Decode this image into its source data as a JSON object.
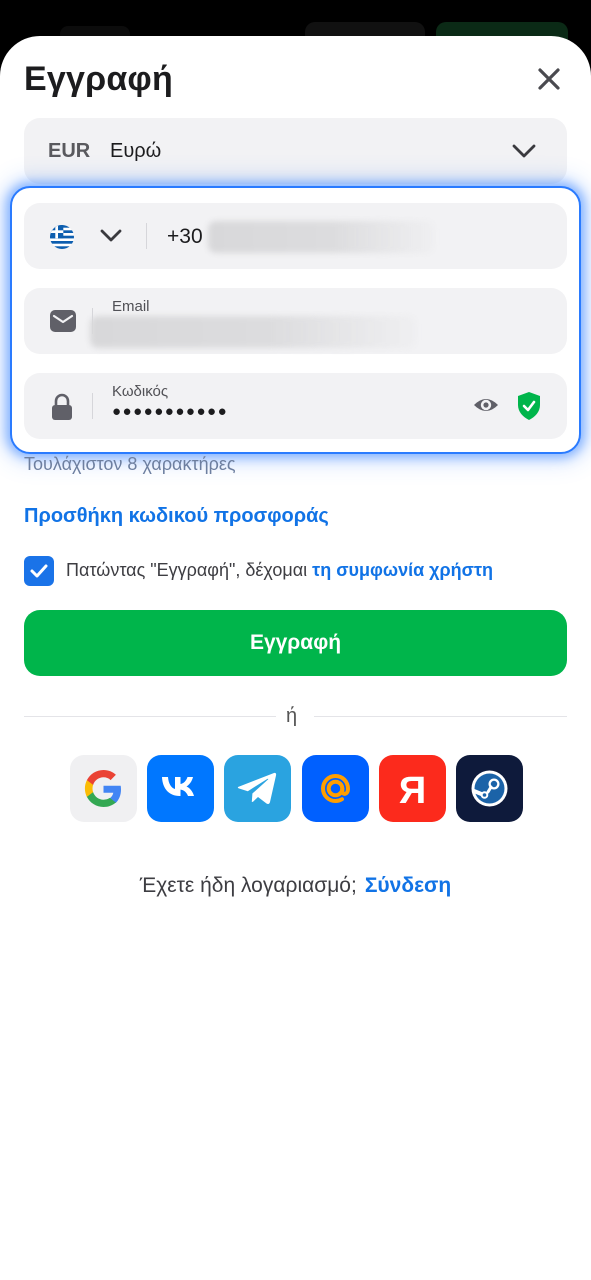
{
  "header": {
    "title": "Εγγραφή",
    "close_icon": "close-icon"
  },
  "currency": {
    "code": "EUR",
    "name": "Ευρώ",
    "icon": "chevron-down-icon"
  },
  "phone": {
    "country_flag": "greece-flag-icon",
    "prefix": "+30",
    "value_hidden": true
  },
  "email": {
    "label": "Email",
    "icon": "envelope-icon",
    "value_hidden": true
  },
  "password": {
    "label": "Κωδικός",
    "masked_value": "●●●●●●●●●●●",
    "icon": "lock-icon",
    "eye_icon": "eye-icon",
    "status_icon": "shield-check-icon",
    "hint": "Τουλάχιστον 8 χαρακτήρες"
  },
  "promo_link": "Προσθήκη κωδικού προσφοράς",
  "agreement": {
    "checked": true,
    "text": "Πατώντας \"Εγγραφή\", δέχομαι ",
    "link": "τη συμφωνία χρήστη"
  },
  "submit_label": "Εγγραφή",
  "divider_text": "ή",
  "social_buttons": [
    {
      "name": "google",
      "bg": "#f0f0f2"
    },
    {
      "name": "vk",
      "bg": "#0077ff"
    },
    {
      "name": "telegram",
      "bg": "#2aa3e0"
    },
    {
      "name": "mail-ru",
      "bg": "#0060ff"
    },
    {
      "name": "yandex",
      "bg": "#fc2a1c"
    },
    {
      "name": "steam",
      "bg": "#0e1a3b"
    }
  ],
  "footer": {
    "question": "Έχετε ήδη λογαριασμό;",
    "login_link": "Σύνδεση"
  },
  "colors": {
    "accent_blue": "#1173e6",
    "submit_green": "#00b54b",
    "focus_border": "#2a7bff"
  }
}
